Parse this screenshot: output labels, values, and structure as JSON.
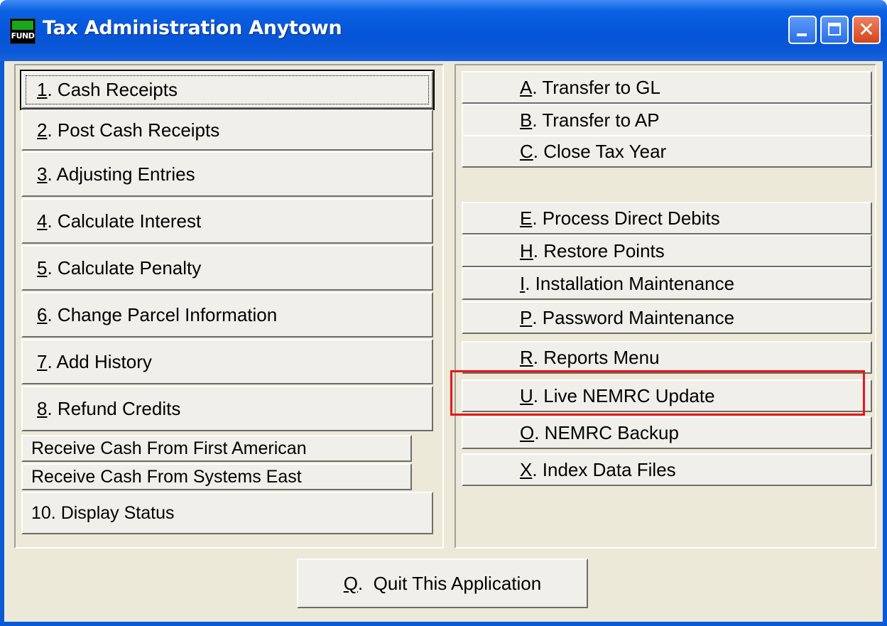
{
  "window": {
    "title": "Tax Administration Anytown",
    "icon_text": "FUND",
    "controls": [
      "minimize-icon",
      "maximize-icon",
      "close-icon"
    ]
  },
  "left_menu": [
    {
      "key": "1",
      "label": ". Cash Receipts"
    },
    {
      "key": "2",
      "label": ". Post Cash Receipts"
    },
    {
      "key": "3",
      "label": ". Adjusting Entries"
    },
    {
      "key": "4",
      "label": ". Calculate Interest"
    },
    {
      "key": "5",
      "label": ". Calculate Penalty"
    },
    {
      "key": "6",
      "label": ". Change Parcel Information"
    },
    {
      "key": "7",
      "label": ". Add History"
    },
    {
      "key": "8",
      "label": ". Refund Credits"
    },
    {
      "key": "",
      "label": "Receive Cash From First American"
    },
    {
      "key": "",
      "label": "Receive Cash From Systems East"
    },
    {
      "key": "",
      "label": "10. Display Status"
    }
  ],
  "right_menu": [
    {
      "key": "A",
      "label": ". Transfer to GL"
    },
    {
      "key": "B",
      "label": ". Transfer to AP"
    },
    {
      "key": "C",
      "label": ". Close Tax Year"
    },
    {
      "key": "E",
      "label": ". Process Direct Debits"
    },
    {
      "key": "H",
      "label": ". Restore Points"
    },
    {
      "key": "I",
      "label": ". Installation Maintenance"
    },
    {
      "key": "P",
      "label": ". Password Maintenance"
    },
    {
      "key": "R",
      "label": ". Reports Menu"
    },
    {
      "key": "U",
      "label": ". Live NEMRC Update"
    },
    {
      "key": "O",
      "label": ". NEMRC Backup"
    },
    {
      "key": "X",
      "label": ". Index Data Files"
    }
  ],
  "quit": {
    "key": "Q",
    "label": ".  Quit This Application"
  },
  "colors": {
    "highlight": "#e51818",
    "titlebar": "#0655d8",
    "face": "#ece9d8"
  }
}
